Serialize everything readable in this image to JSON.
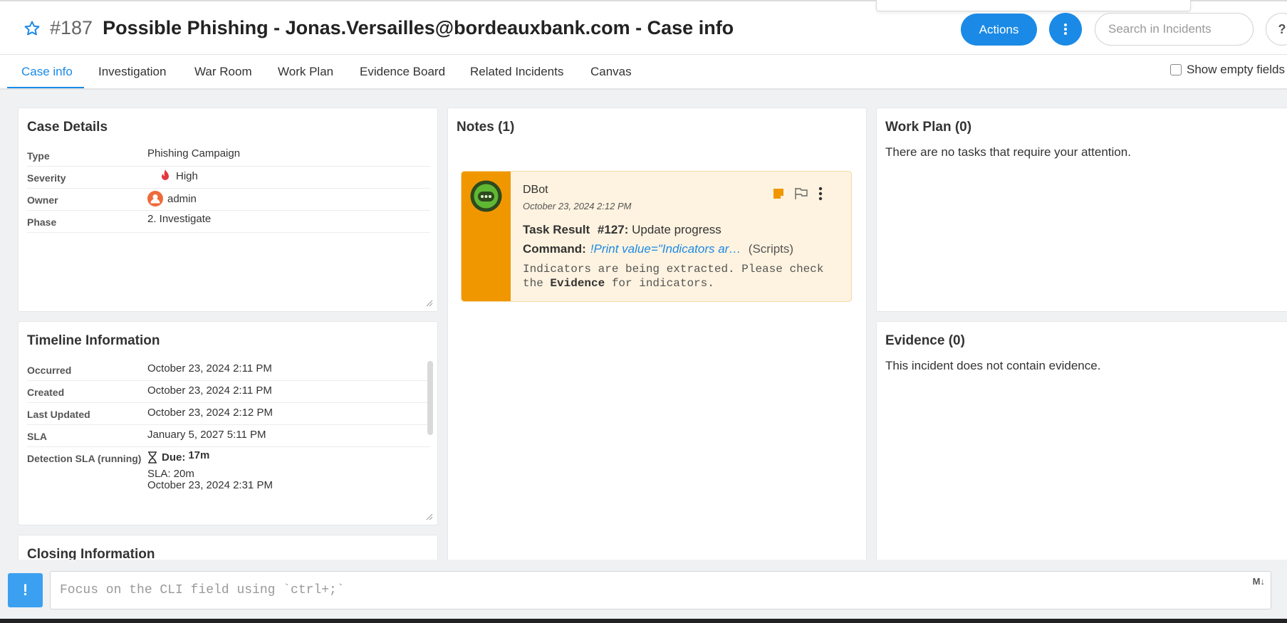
{
  "header": {
    "case_number": "#187",
    "case_title": "Possible Phishing - Jonas.Versailles@bordeauxbank.com - Case info",
    "actions_label": "Actions",
    "search_placeholder": "Search in Incidents",
    "help_label": "?"
  },
  "tabs": [
    {
      "label": "Case info",
      "active": true
    },
    {
      "label": "Investigation"
    },
    {
      "label": "War Room"
    },
    {
      "label": "Work Plan"
    },
    {
      "label": "Evidence Board"
    },
    {
      "label": "Related Incidents"
    },
    {
      "label": "Canvas"
    }
  ],
  "show_empty_fields_label": "Show empty fields",
  "case_details": {
    "title": "Case Details",
    "rows": [
      {
        "label": "Type",
        "value": "Phishing Campaign"
      },
      {
        "label": "Severity",
        "value": "High",
        "icon": "flame-icon"
      },
      {
        "label": "Owner",
        "value": "admin",
        "icon": "user-icon"
      },
      {
        "label": "Phase",
        "value": "2. Investigate"
      }
    ]
  },
  "timeline": {
    "title": "Timeline Information",
    "rows": [
      {
        "label": "Occurred",
        "value": "October 23, 2024 2:11 PM"
      },
      {
        "label": "Created",
        "value": "October 23, 2024 2:11 PM"
      },
      {
        "label": "Last Updated",
        "value": "October 23, 2024 2:12 PM"
      },
      {
        "label": "SLA",
        "value": "January 5, 2027 5:11 PM"
      }
    ],
    "detection_sla": {
      "label": "Detection SLA (running)",
      "due_label": "Due:",
      "due_value": "17m",
      "sla_line": "SLA: 20m",
      "date_line": "October 23, 2024 2:31 PM"
    }
  },
  "closing": {
    "title": "Closing Information"
  },
  "notes": {
    "title": "Notes (1)",
    "note": {
      "author": "DBot",
      "date": "October 23, 2024 2:12 PM",
      "task_label": "Task Result",
      "task_id": "#127:",
      "task_name": "Update progress",
      "command_label": "Command:",
      "command_value": "!Print value=\"Indicators are being extracted. Please check the Evidence for indicators.\"",
      "command_source": "(Scripts)",
      "body_pre": "Indicators are being extracted. Please check the ",
      "body_bold": "Evidence",
      "body_post": " for indicators."
    }
  },
  "work_plan": {
    "title": "Work Plan (0)",
    "empty_text": "There are no tasks that require your attention."
  },
  "evidence": {
    "title": "Evidence (0)",
    "empty_text": "This incident does not contain evidence."
  },
  "cli": {
    "prefix": "!",
    "placeholder": "Focus on the CLI field using `ctrl+;`",
    "markdown_label": "M↓"
  },
  "colors": {
    "accent": "#1b8ae6",
    "note_bar": "#f09700",
    "note_bg": "#fef3e0",
    "severity_high": "#e0393e"
  }
}
